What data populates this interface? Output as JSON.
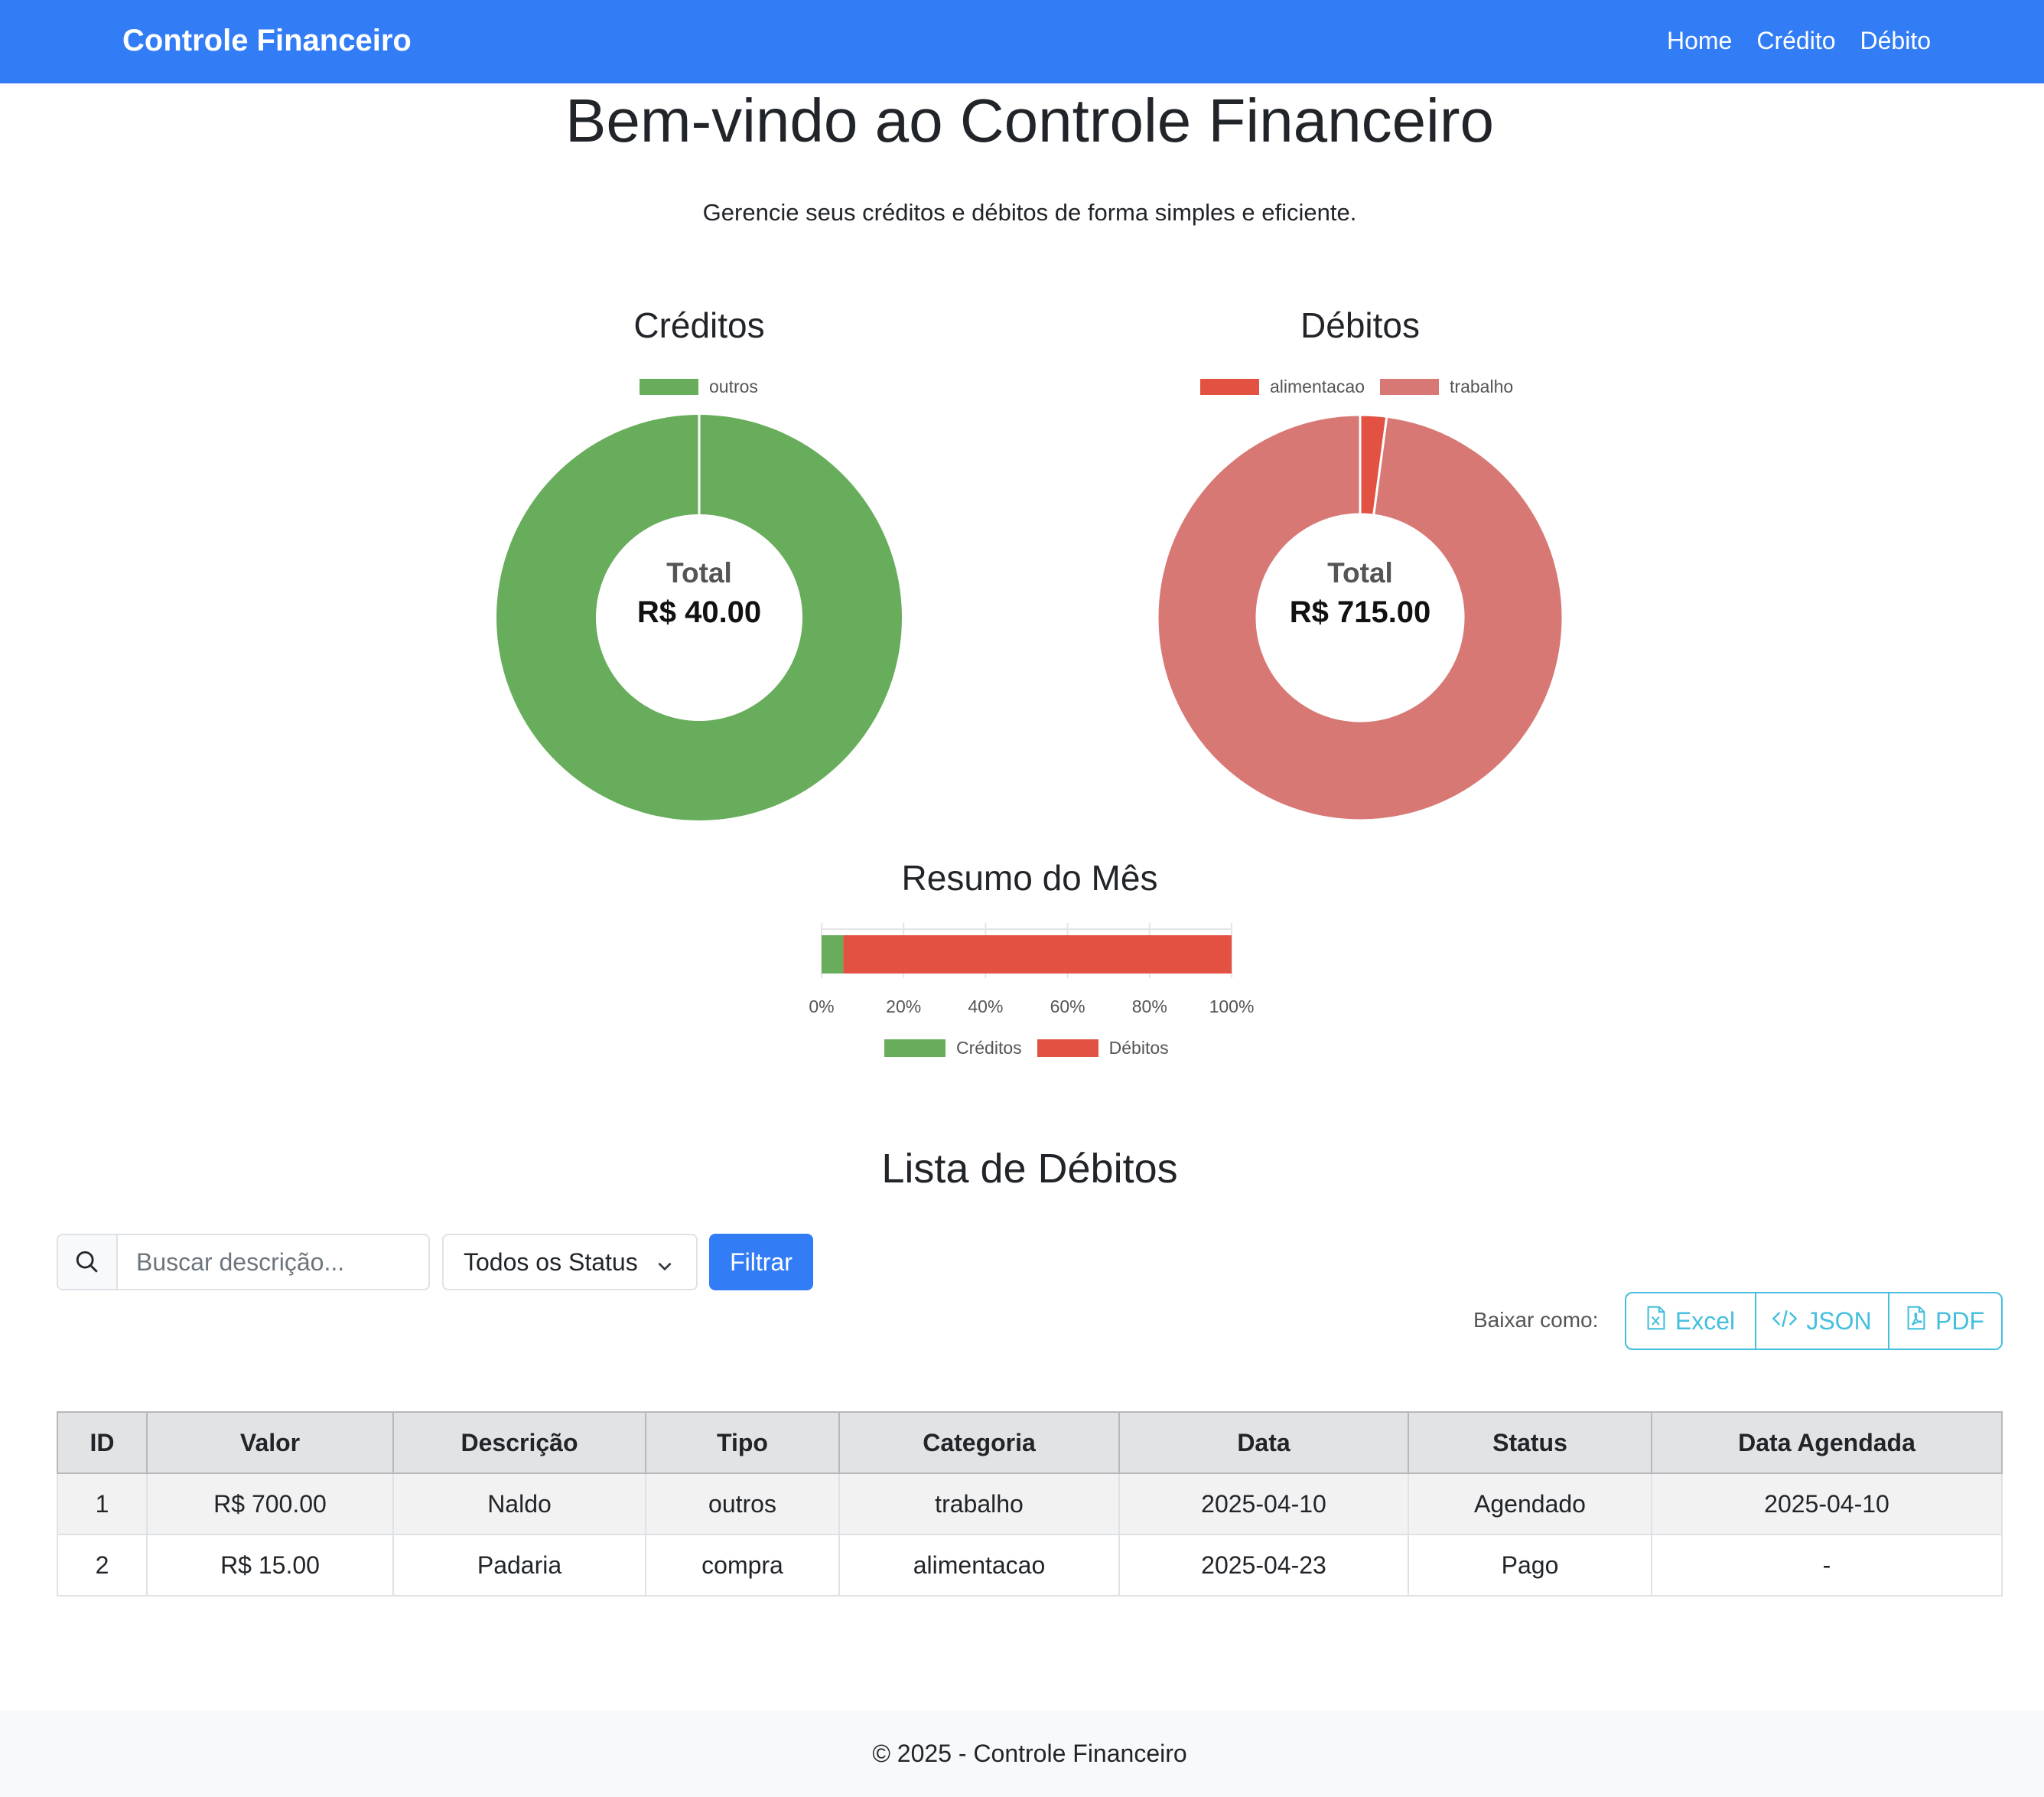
{
  "navbar": {
    "brand": "Controle Financeiro",
    "links": [
      "Home",
      "Crédito",
      "Débito"
    ],
    "color": "#327df6"
  },
  "hero": {
    "title": "Bem-vindo ao Controle Financeiro",
    "subtitle": "Gerencie seus créditos e débitos de forma simples e eficiente."
  },
  "chart_data": [
    {
      "type": "pie",
      "title": "Créditos",
      "categories": [
        "outros"
      ],
      "values": [
        40.0
      ],
      "colors": [
        "#68ad5c"
      ],
      "center_label": "Total",
      "center_value": "R$ 40.00",
      "legend": "top"
    },
    {
      "type": "pie",
      "title": "Débitos",
      "categories": [
        "alimentacao",
        "trabalho"
      ],
      "values": [
        15.0,
        700.0
      ],
      "colors": [
        "#e25141",
        "#d77875"
      ],
      "center_label": "Total",
      "center_value": "R$ 715.00",
      "legend": "top"
    },
    {
      "type": "bar",
      "title": "Resumo do Mês",
      "orientation": "horizontal",
      "stacked": true,
      "series": [
        {
          "name": "Créditos",
          "values": [
            40.0
          ],
          "color": "#68ad5c"
        },
        {
          "name": "Débitos",
          "values": [
            715.0
          ],
          "color": "#e25141"
        }
      ],
      "xticks": [
        "0%",
        "20%",
        "40%",
        "60%",
        "80%",
        "100%"
      ],
      "xlim": [
        0,
        100
      ],
      "grid": true,
      "legend": "bottom"
    }
  ],
  "debits": {
    "title": "Lista de Débitos",
    "search_placeholder": "Buscar descrição...",
    "status_selected": "Todos os Status",
    "filter_label": "Filtrar",
    "download_label": "Baixar como:",
    "download_buttons": [
      "Excel",
      "JSON",
      "PDF"
    ],
    "columns": [
      "ID",
      "Valor",
      "Descrição",
      "Tipo",
      "Categoria",
      "Data",
      "Status",
      "Data Agendada"
    ],
    "rows": [
      [
        "1",
        "R$ 700.00",
        "Naldo",
        "outros",
        "trabalho",
        "2025-04-10",
        "Agendado",
        "2025-04-10"
      ],
      [
        "2",
        "R$ 15.00",
        "Padaria",
        "compra",
        "alimentacao",
        "2025-04-23",
        "Pago",
        "-"
      ]
    ]
  },
  "footer": {
    "text": "© 2025 - Controle Financeiro"
  },
  "icons": {
    "search": "search-icon",
    "chevron": "chevron-down-icon",
    "excel": "file-excel-icon",
    "json": "code-icon",
    "pdf": "file-pdf-icon"
  },
  "colors": {
    "accent": "#327df6",
    "info": "#44bfdd",
    "credit": "#68ad5c",
    "debit": "#e25141",
    "debit_light": "#d77875"
  }
}
